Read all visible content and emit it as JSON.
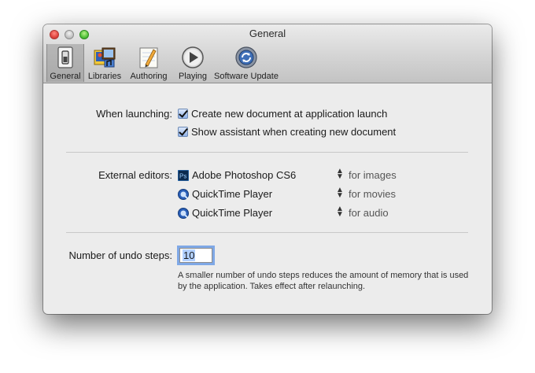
{
  "window": {
    "title": "General"
  },
  "toolbar": {
    "items": [
      {
        "label": "General",
        "icon": "switch-icon",
        "selected": true
      },
      {
        "label": "Libraries",
        "icon": "libraries-icon",
        "selected": false
      },
      {
        "label": "Authoring",
        "icon": "pencil-icon",
        "selected": false
      },
      {
        "label": "Playing",
        "icon": "play-icon",
        "selected": false
      },
      {
        "label": "Software Update",
        "icon": "software-update-icon",
        "selected": false
      }
    ]
  },
  "launching": {
    "label": "When launching:",
    "options": [
      {
        "label": "Create new document at application launch",
        "checked": true
      },
      {
        "label": "Show assistant when creating new document",
        "checked": true
      }
    ]
  },
  "editors": {
    "label": "External editors:",
    "rows": [
      {
        "app": "Adobe Photoshop CS6",
        "icon": "photoshop-icon",
        "purpose": "for images"
      },
      {
        "app": "QuickTime Player",
        "icon": "quicktime-icon",
        "purpose": "for movies"
      },
      {
        "app": "QuickTime Player",
        "icon": "quicktime-icon",
        "purpose": "for audio"
      }
    ]
  },
  "undo": {
    "label": "Number of undo steps:",
    "value": "10",
    "help": "A smaller number of undo steps reduces the amount of memory that is used by the application. Takes effect after relaunching."
  },
  "colors": {
    "selection_focus": "#7fa8e6",
    "checkbox": "#8fb1e6"
  }
}
